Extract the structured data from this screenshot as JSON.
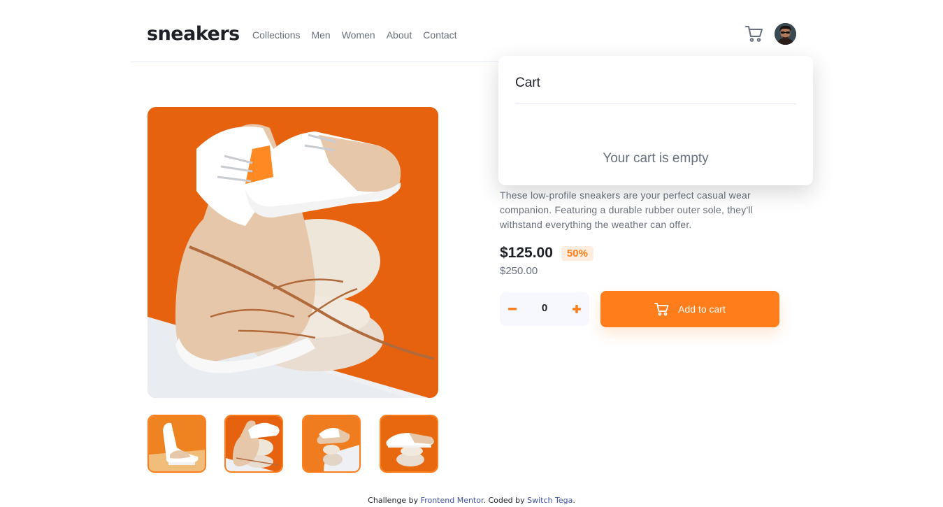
{
  "brand": {
    "logo_text": "sneakers",
    "accent_color": "#ff7d1a"
  },
  "nav": {
    "items": [
      {
        "label": "Collections"
      },
      {
        "label": "Men"
      },
      {
        "label": "Women"
      },
      {
        "label": "About"
      },
      {
        "label": "Contact"
      }
    ]
  },
  "header": {
    "cart_icon": "cart-icon",
    "avatar_icon": "user-avatar"
  },
  "product": {
    "description": "These low-profile sneakers are your perfect casual wear companion. Featuring a durable rubber outer sole, they'll withstand everything the weather can offer.",
    "price": "$125.00",
    "discount": "50%",
    "original_price": "$250.00",
    "quantity": "0",
    "add_to_cart_label": "Add to cart",
    "thumbnail_count": 4,
    "selected_thumbnail": 1
  },
  "cart": {
    "title": "Cart",
    "empty_message": "Your cart is empty"
  },
  "footer": {
    "prefix": "Challenge by ",
    "link1": "Frontend Mentor",
    "middle": ". Coded by ",
    "link2": "Switch Tega",
    "suffix": "."
  }
}
